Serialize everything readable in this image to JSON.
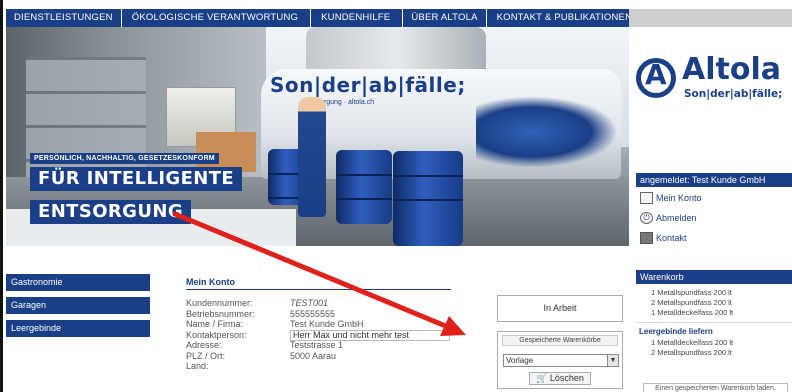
{
  "nav": {
    "items": [
      {
        "label": "DIENSTLEISTUNGEN"
      },
      {
        "label": "ÖKOLOGISCHE VERANTWORTUNG"
      },
      {
        "label": "KUNDENHILFE"
      },
      {
        "label": "ÜBER ALTOLA"
      },
      {
        "label": "KONTAKT & PUBLIKATIONEN"
      }
    ]
  },
  "hero": {
    "tagline": "PERSÖNLICH, NACHHALTIG, GESETZESKONFORM",
    "headline_1": "FÜR INTELLIGENTE",
    "headline_2": "ENTSORGUNG",
    "truck_text": "Son|der|ab|fälle;",
    "truck_subtext": "Entsorgung  ·  altola.ch"
  },
  "logo": {
    "name": "Altola",
    "subtitle": "Son|der|ab|fälle;"
  },
  "user": {
    "logged_in": "angemeldet: Test Kunde GmbH",
    "links": [
      "Mein Konto",
      "Abmelden",
      "Kontakt"
    ]
  },
  "sidebar": {
    "items": [
      {
        "label": "Gastronomie"
      },
      {
        "label": "Garagen"
      },
      {
        "label": "Leergebinde"
      }
    ]
  },
  "account": {
    "title": "Mein Konto",
    "fields": [
      {
        "label": "Kundennummer:",
        "value": "TEST001"
      },
      {
        "label": "Betriebsnummer:",
        "value": "555555555"
      },
      {
        "label": "Name / Firma:",
        "value": "Test Kunde GmbH"
      },
      {
        "label": "Kontaktperson:",
        "value": "Herr Max und nicht mehr test"
      },
      {
        "label": "Adresse:",
        "value": "Teststrasse 1"
      },
      {
        "label": "PLZ / Ort:",
        "value": "5000 Aarau"
      },
      {
        "label": "Land:",
        "value": ""
      }
    ]
  },
  "status": {
    "in_arbeit": "In Arbeit",
    "saved_title": "Gespeicherte Warenkörbe",
    "select_value": "Vorlage",
    "delete_label": "Löschen"
  },
  "cart": {
    "title": "Warenkorb",
    "items": [
      "1 Metallspundfass 200 lt",
      "2 Metallspundfass 200 lt",
      "1 Metalldeckelfass 200 lt"
    ],
    "deliver_title": "Leergebinde liefern",
    "deliver_items": [
      "1 Metalldeckelfass 200 lt",
      "2 Metallspundfass 200 lt"
    ],
    "load_label": "Einen gespeicherten Warenkorb laden."
  },
  "colors": {
    "brand": "#1b3f86",
    "arrow": "#e0201b"
  },
  "icons": [
    "user-card-icon",
    "power-icon",
    "mail-icon",
    "basket-icon",
    "dropdown-arrow-icon"
  ]
}
